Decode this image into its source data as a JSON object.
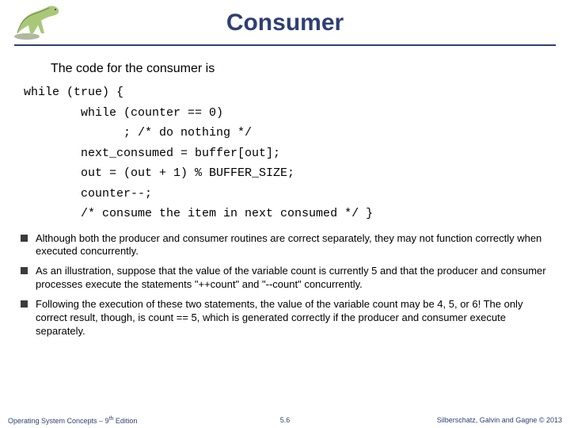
{
  "title": "Consumer",
  "intro": "The code for the consumer is",
  "code": "while (true) {\n        while (counter == 0)\n              ; /* do nothing */\n        next_consumed = buffer[out];\n        out = (out + 1) % BUFFER_SIZE;\n        counter--;\n        /* consume the item in next consumed */ }",
  "bullets": [
    "Although both the producer and consumer routines are correct separately, they may not function correctly when executed concurrently.",
    "As an illustration, suppose that the value of the variable count is currently 5 and that the producer and consumer processes execute the statements \"++count\" and \"--count\" concurrently.",
    "Following the execution of these two statements, the value of the variable count may be 4, 5, or 6! The only correct result, though, is count == 5, which is generated correctly if the producer and consumer execute separately."
  ],
  "footer": {
    "left_a": "Operating System Concepts – 9",
    "left_b": " Edition",
    "sup": "th",
    "mid": "5.6",
    "right": "Silberschatz, Galvin and Gagne © 2013"
  }
}
